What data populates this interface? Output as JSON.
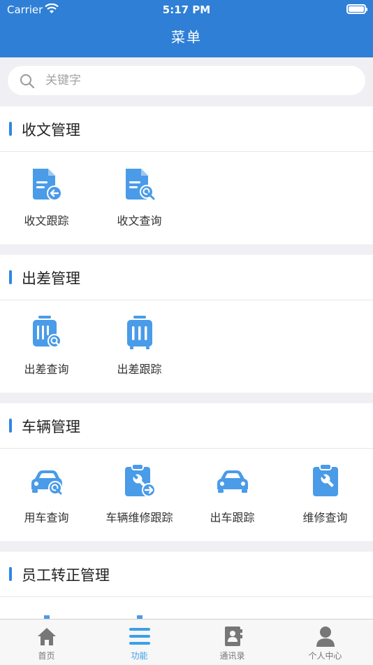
{
  "status": {
    "carrier": "Carrier",
    "time": "5:17 PM"
  },
  "nav": {
    "title": "菜单"
  },
  "search": {
    "placeholder": "关键字"
  },
  "colors": {
    "primary": "#2f7fd6",
    "icon": "#4a9be8",
    "active_tab": "#3aa0e8"
  },
  "sections": [
    {
      "title": "收文管理",
      "items": [
        {
          "label": "收文跟踪",
          "icon": "document-back-icon"
        },
        {
          "label": "收文查询",
          "icon": "document-search-icon"
        }
      ]
    },
    {
      "title": "出差管理",
      "items": [
        {
          "label": "出差查询",
          "icon": "luggage-search-icon"
        },
        {
          "label": "出差跟踪",
          "icon": "luggage-icon"
        }
      ]
    },
    {
      "title": "车辆管理",
      "items": [
        {
          "label": "用车查询",
          "icon": "car-search-icon"
        },
        {
          "label": "车辆维修跟踪",
          "icon": "repair-clipboard-forward-icon"
        },
        {
          "label": "出车跟踪",
          "icon": "car-icon"
        },
        {
          "label": "维修查询",
          "icon": "repair-clipboard-icon"
        }
      ]
    },
    {
      "title": "员工转正管理",
      "items": []
    }
  ],
  "tabs": [
    {
      "label": "首页",
      "icon": "home-icon"
    },
    {
      "label": "功能",
      "icon": "menu-list-icon",
      "active": true
    },
    {
      "label": "通讯录",
      "icon": "contacts-book-icon"
    },
    {
      "label": "个人中心",
      "icon": "person-icon"
    }
  ]
}
